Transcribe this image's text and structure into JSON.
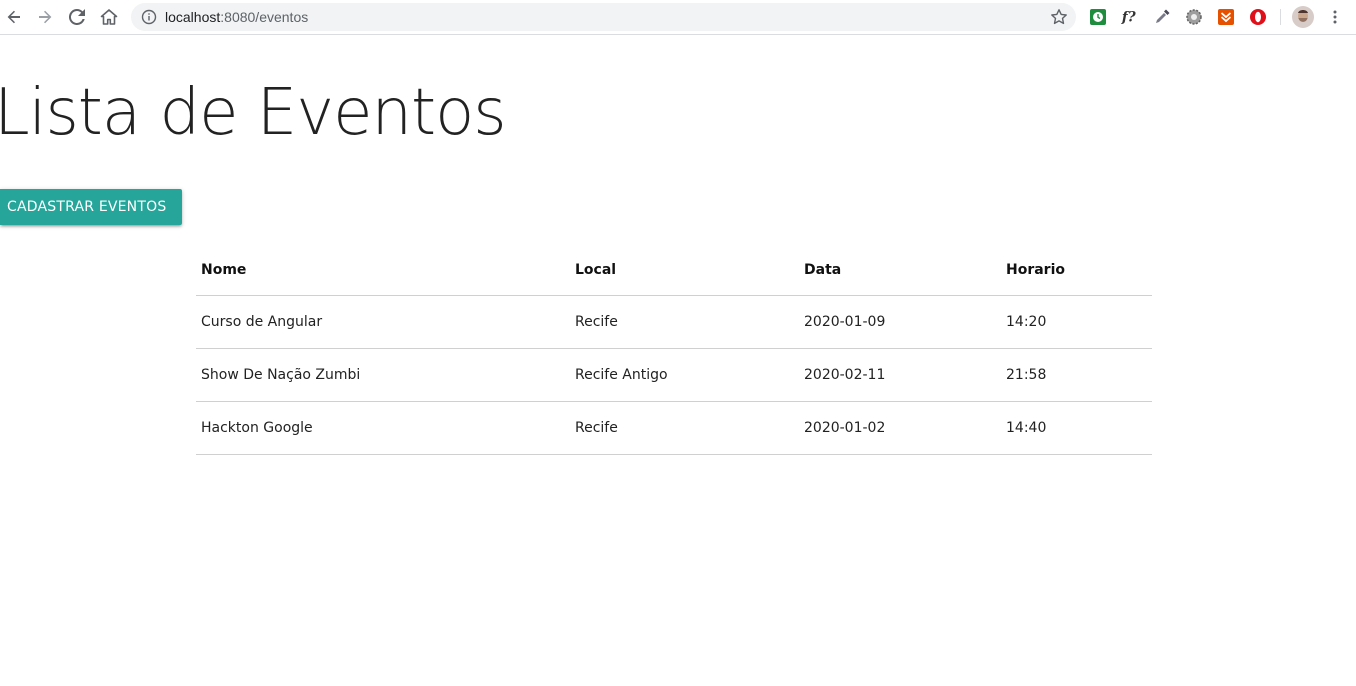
{
  "browser": {
    "url_host": "localhost",
    "url_rest": ":8080/eventos",
    "icons": [
      "back-icon",
      "forward-icon",
      "reload-icon",
      "home-icon",
      "info-icon",
      "star-icon",
      "kebab-menu-icon"
    ],
    "extensions": [
      "clock-extension-icon",
      "font-extension-icon",
      "eyedropper-extension-icon",
      "gear-extension-icon",
      "download-extension-icon",
      "opera-extension-icon",
      "profile-avatar-icon"
    ]
  },
  "page": {
    "title": "Lista de Eventos",
    "add_button_label": "CADASTRAR EVENTOS"
  },
  "table": {
    "headers": {
      "nome": "Nome",
      "local": "Local",
      "data": "Data",
      "horario": "Horario"
    },
    "rows": [
      {
        "nome": "Curso de Angular",
        "local": "Recife",
        "data": "2020-01-09",
        "horario": "14:20"
      },
      {
        "nome": "Show De Nação Zumbi",
        "local": "Recife Antigo",
        "data": "2020-02-11",
        "horario": "21:58"
      },
      {
        "nome": "Hackton Google",
        "local": "Recife",
        "data": "2020-01-02",
        "horario": "14:40"
      }
    ]
  },
  "colors": {
    "accent": "#26a69a",
    "text": "#222222",
    "divider": "#d0d0d0"
  }
}
